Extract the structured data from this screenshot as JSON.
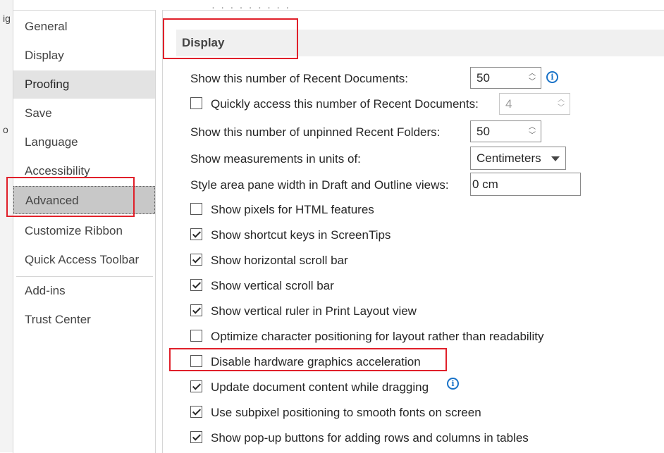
{
  "left_strip": {
    "chars": [
      "ig",
      "o"
    ]
  },
  "sidebar": {
    "items": [
      {
        "label": "General"
      },
      {
        "label": "Display"
      },
      {
        "label": "Proofing"
      },
      {
        "label": "Save"
      },
      {
        "label": "Language"
      },
      {
        "label": "Accessibility"
      },
      {
        "label": "Advanced"
      },
      {
        "label": "Customize Ribbon"
      },
      {
        "label": "Quick Access Toolbar"
      },
      {
        "label": "Add-ins"
      },
      {
        "label": "Trust Center"
      }
    ],
    "selected": "Proofing",
    "hovered": "Advanced"
  },
  "main": {
    "top_cut_text": "· · ·   · · · ·   · ·",
    "section_title": "Display",
    "recent_docs": {
      "label": "Show this number of Recent Documents:",
      "value": "50"
    },
    "quick_access": {
      "label": "Quickly access this number of Recent Documents:",
      "value": "4",
      "checked": false
    },
    "unpinned_folders": {
      "label": "Show this number of unpinned Recent Folders:",
      "value": "50"
    },
    "measurements": {
      "label": "Show measurements in units of:",
      "value": "Centimeters"
    },
    "style_area": {
      "label": "Style area pane width in Draft and Outline views:",
      "value": "0 cm"
    },
    "checkboxes": [
      {
        "label": "Show pixels for HTML features",
        "checked": false
      },
      {
        "label": "Show shortcut keys in ScreenTips",
        "checked": true
      },
      {
        "label": "Show horizontal scroll bar",
        "checked": true
      },
      {
        "label": "Show vertical scroll bar",
        "checked": true
      },
      {
        "label": "Show vertical ruler in Print Layout view",
        "checked": true
      },
      {
        "label": "Optimize character positioning for layout rather than readability",
        "checked": false
      },
      {
        "label": "Disable hardware graphics acceleration",
        "checked": false
      },
      {
        "label": "Update document content while dragging",
        "checked": true
      },
      {
        "label": "Use subpixel positioning to smooth fonts on screen",
        "checked": true
      },
      {
        "label": "Show pop-up buttons for adding rows and columns in tables",
        "checked": true
      }
    ],
    "info_icon_glyph": "i"
  },
  "colors": {
    "highlight_box": "#e0202a",
    "info_blue": "#1a73c8"
  }
}
